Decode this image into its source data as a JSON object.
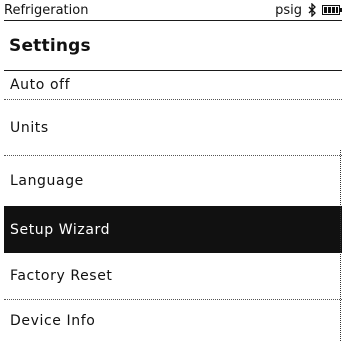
{
  "status_bar": {
    "mode": "Refrigeration",
    "unit": "psig",
    "icons": [
      "bluetooth-icon",
      "battery-icon"
    ]
  },
  "header": {
    "title": "Settings"
  },
  "menu": {
    "items": [
      {
        "label": "Auto off",
        "selected": false
      },
      {
        "label": "Units",
        "selected": false
      },
      {
        "label": "Language",
        "selected": false
      },
      {
        "label": "Setup Wizard",
        "selected": true
      },
      {
        "label": "Factory Reset",
        "selected": false
      },
      {
        "label": "Device Info",
        "selected": false
      }
    ]
  },
  "colors": {
    "foreground": "#111111",
    "background": "#ffffff",
    "selection": "#111111"
  }
}
